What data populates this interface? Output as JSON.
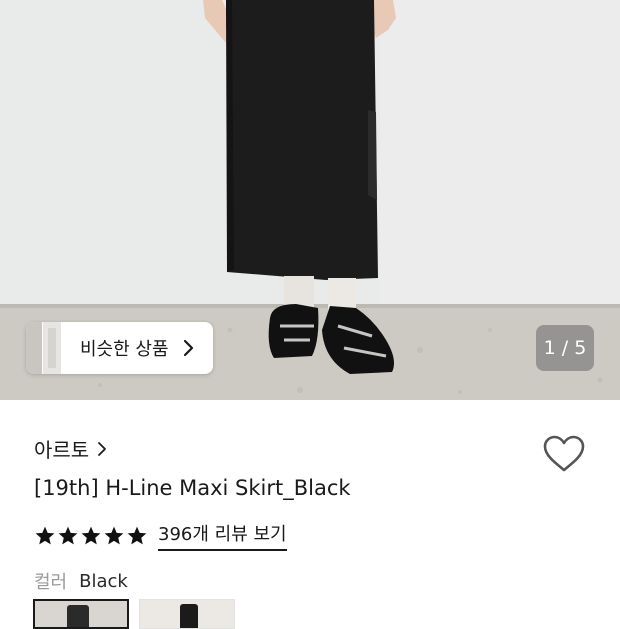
{
  "similar_products": {
    "label": "비슷한 상품"
  },
  "image_counter": {
    "text": "1 / 5",
    "current": 1,
    "total": 5
  },
  "brand": {
    "name": "아르토"
  },
  "product": {
    "title": "[19th] H-Line Maxi Skirt_Black"
  },
  "rating": {
    "stars": 5,
    "review_link": "396개 리뷰 보기"
  },
  "color_option": {
    "label": "컬러",
    "value": "Black"
  },
  "icons": [
    "chevron-right-icon",
    "heart-icon",
    "star-icon"
  ],
  "colors": {
    "text": "#1a1a1a",
    "muted": "#9a9a9a",
    "counter_bg": "#787878"
  }
}
